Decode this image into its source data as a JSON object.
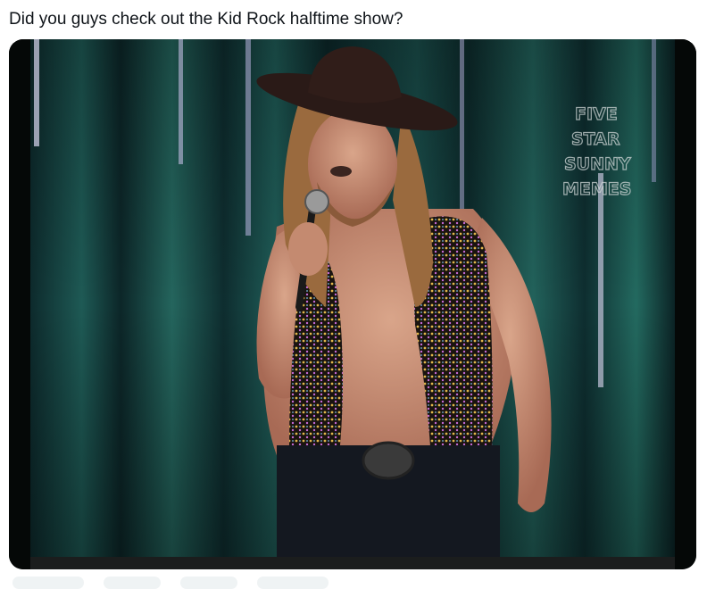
{
  "post": {
    "text": "Did you guys check out the Kid Rock halftime show?"
  },
  "media": {
    "description_icon": "photo",
    "watermark_lines": [
      "FIVE",
      "STAR",
      "SUNNY",
      "MEMES"
    ]
  },
  "actions": [
    {
      "icon": "reply-icon"
    },
    {
      "icon": "repost-icon"
    },
    {
      "icon": "like-icon"
    },
    {
      "icon": "views-icon"
    }
  ]
}
